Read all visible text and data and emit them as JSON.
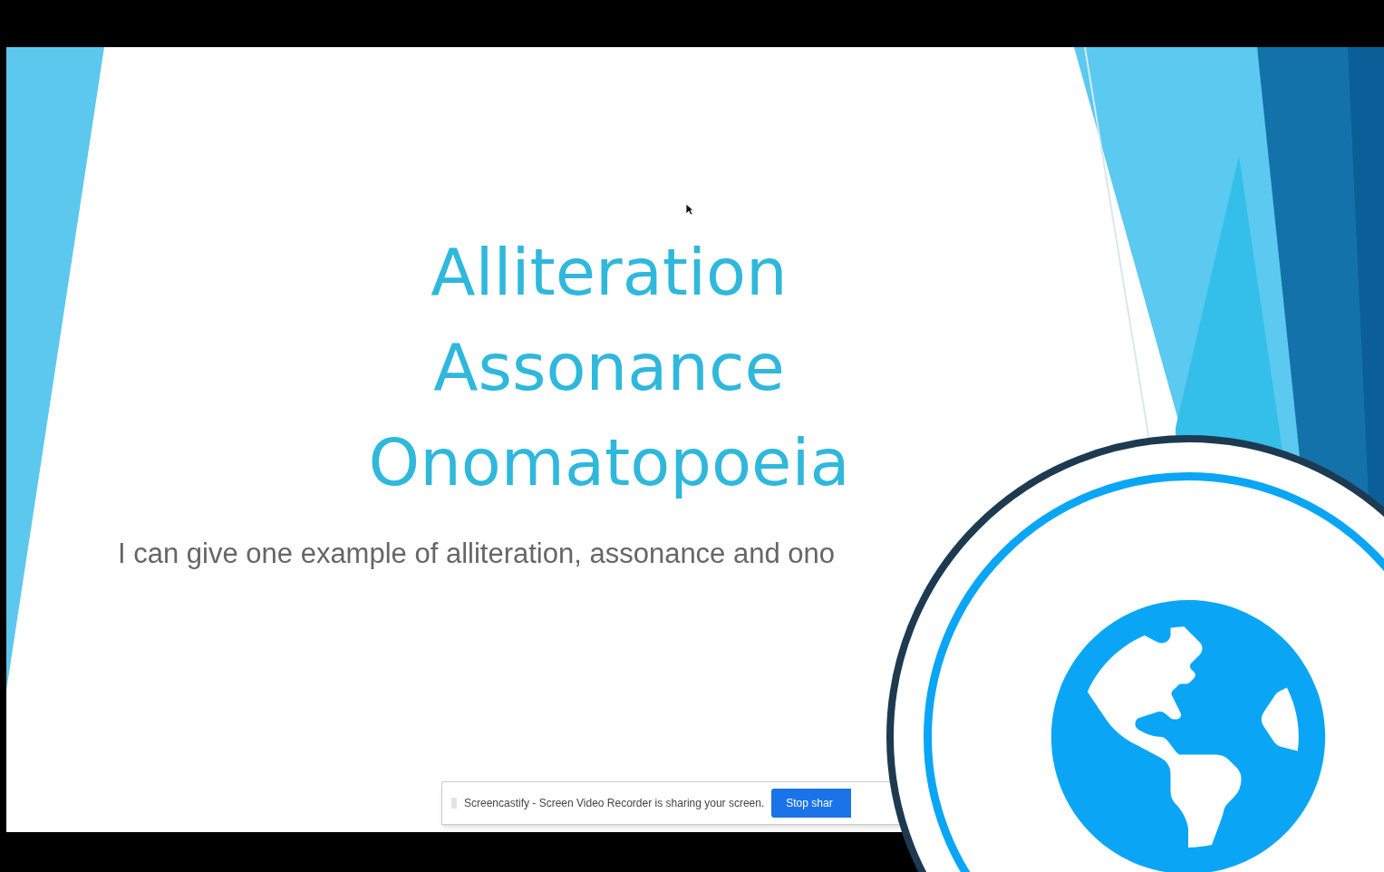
{
  "slide": {
    "title_lines": [
      "Alliteration",
      "Assonance",
      "Onomatopoeia"
    ],
    "subtitle": "I can give one example of alliteration, assonance and ono"
  },
  "share_bar": {
    "message": "Screencastify - Screen Video Recorder is sharing your screen.",
    "button": "Stop shar"
  }
}
